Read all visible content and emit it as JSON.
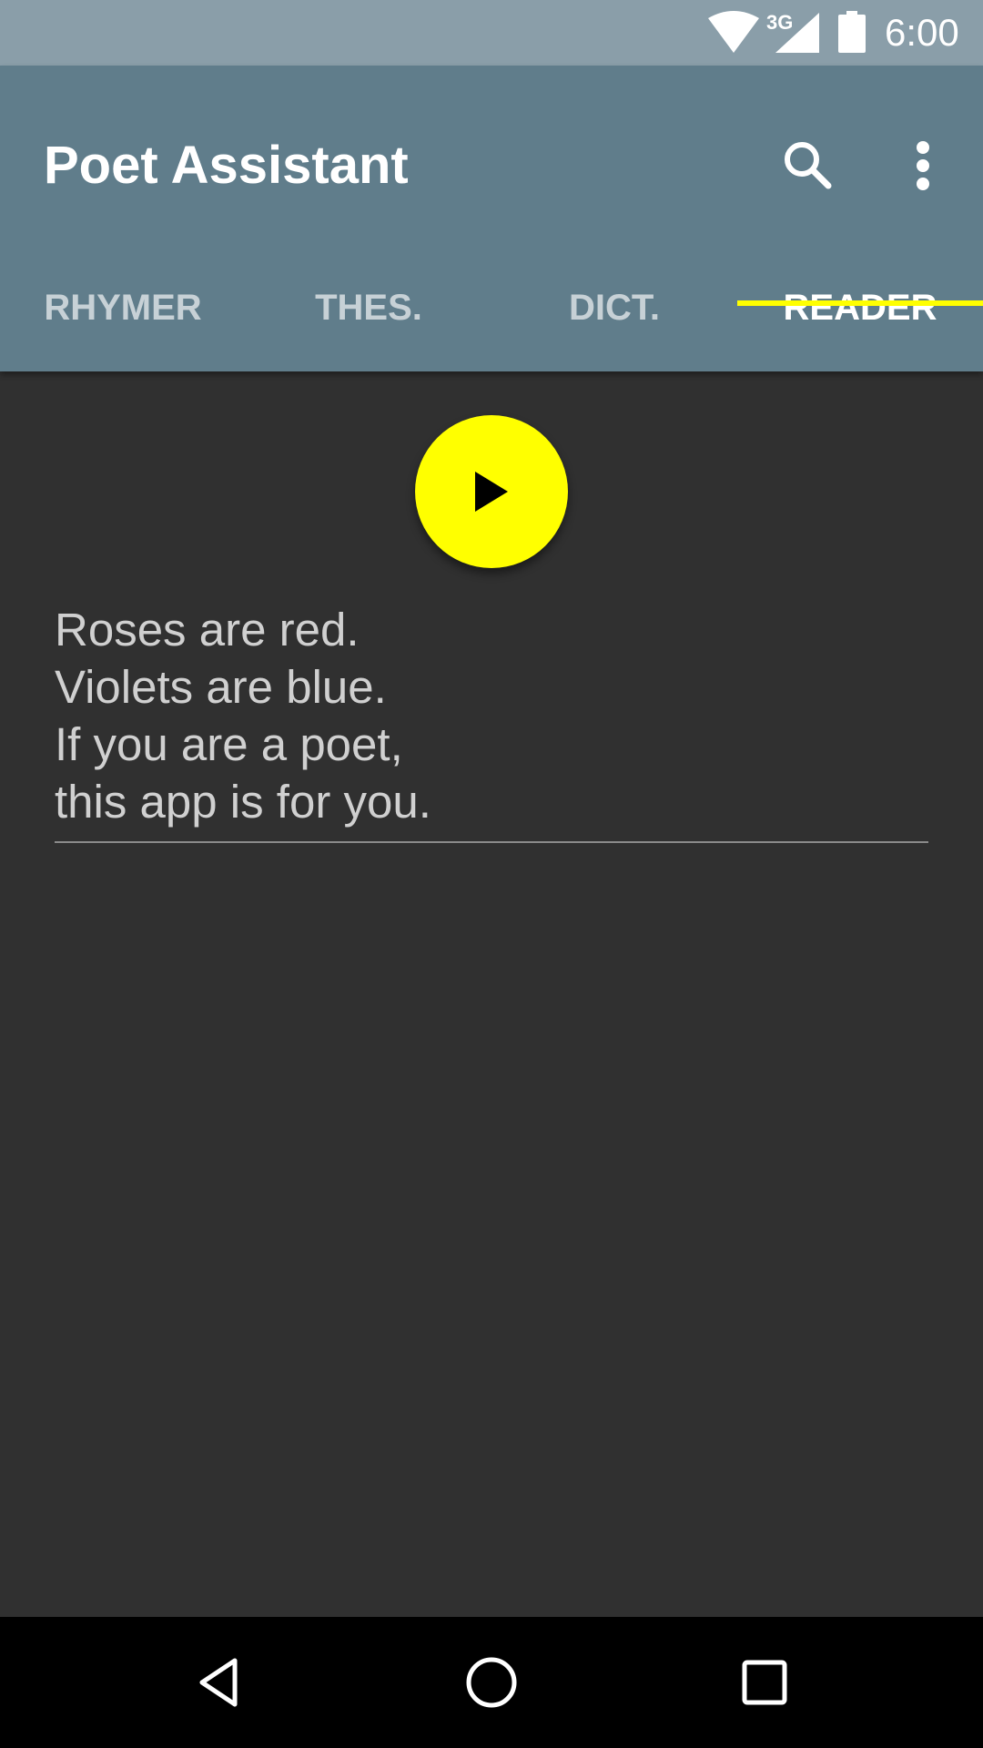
{
  "status_bar": {
    "network_type": "3G",
    "time": "6:00",
    "icons": [
      "wifi-icon",
      "signal-icon",
      "battery-icon"
    ]
  },
  "app_bar": {
    "title": "Poet Assistant",
    "actions": [
      "search-icon",
      "more-vert-icon"
    ]
  },
  "tabs": [
    {
      "label": "RHYMER",
      "selected": false
    },
    {
      "label": "THES.",
      "selected": false
    },
    {
      "label": "DICT.",
      "selected": false
    },
    {
      "label": "READER",
      "selected": true
    }
  ],
  "reader": {
    "play_icon": "play-icon",
    "poem_lines": [
      "Roses are red.",
      "Violets are blue.",
      "If you are a poet,",
      "this app is for you."
    ]
  },
  "nav_bar": {
    "icons": [
      "back-icon",
      "home-icon",
      "recents-icon"
    ]
  },
  "colors": {
    "status_bar": "#8a9ea9",
    "app_bar": "#607d8b",
    "background": "#303030",
    "accent": "#ffff00",
    "poem_text": "#d0d0d0"
  }
}
